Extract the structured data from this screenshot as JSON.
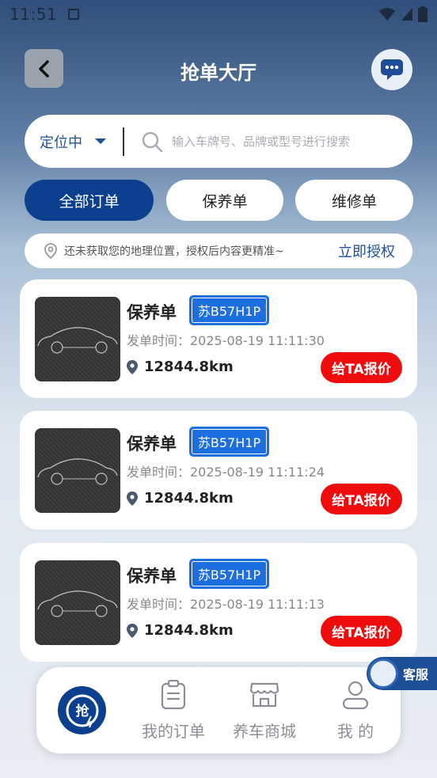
{
  "statusbar": {
    "time": "11:51"
  },
  "header": {
    "title": "抢单大厅"
  },
  "search": {
    "location_label": "定位中",
    "placeholder": "输入车牌号、品牌或型号进行搜索"
  },
  "tabs": [
    {
      "label": "全部订单",
      "active": true
    },
    {
      "label": "保养单",
      "active": false
    },
    {
      "label": "维修单",
      "active": false
    }
  ],
  "location_tip": {
    "text": "还未获取您的地理位置，授权后内容更精准~",
    "action_label": "立即授权"
  },
  "orders": [
    {
      "type": "保养单",
      "plate": "苏B57H1P",
      "time": "发单时间：2025-08-19 11:11:30",
      "distance": "12844.8km",
      "action": "给TA报价"
    },
    {
      "type": "保养单",
      "plate": "苏B57H1P",
      "time": "发单时间：2025-08-19 11:11:24",
      "distance": "12844.8km",
      "action": "给TA报价"
    },
    {
      "type": "保养单",
      "plate": "苏B57H1P",
      "time": "发单时间：2025-08-19 11:11:13",
      "distance": "12844.8km",
      "action": "给TA报价"
    }
  ],
  "customer_service": {
    "label": "客服"
  },
  "bottom_nav": {
    "items": [
      {
        "label": "",
        "icon": "grab-order-icon"
      },
      {
        "label": "我的订单",
        "icon": "clipboard-icon"
      },
      {
        "label": "养车商城",
        "icon": "store-icon"
      },
      {
        "label": "我 的",
        "icon": "user-icon"
      }
    ]
  },
  "colors": {
    "primary": "#0d3f8f",
    "accent_red": "#ee0c0c",
    "plate_blue": "#1d6fe0",
    "link_blue": "#1f4e99"
  }
}
